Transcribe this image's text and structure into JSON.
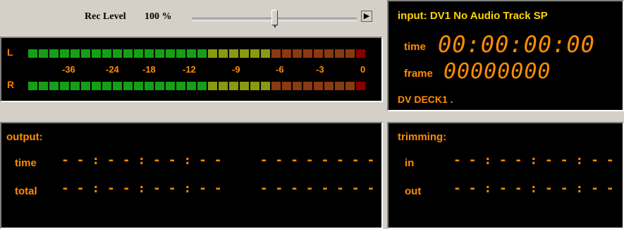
{
  "rec_level": {
    "label": "Rec Level",
    "value": "100 %",
    "slider_fraction": 0.5,
    "mute_icon": "speaker-icon"
  },
  "meter": {
    "left_label": "L",
    "right_label": "R",
    "scale": [
      "-36",
      "-24",
      "-18",
      "-12",
      "-9",
      "-6",
      "-3",
      "0"
    ],
    "colors": {
      "green": "#14a014",
      "yellow": "#8a9a10",
      "orange": "#8a3a10",
      "red": "#8a0000"
    }
  },
  "input": {
    "header": "input:  DV1  No Audio Track  SP",
    "time_label": "time",
    "time_value": "00:00:00:00",
    "frame_label": "frame",
    "frame_value": "00000000",
    "deck": "DV DECK1 ."
  },
  "output": {
    "title": "output:",
    "time_label": "time",
    "time_value": "- - : - - : - - : - -     - - - - - - - -",
    "total_label": "total",
    "total_value": "- - : - - : - - : - -     - - - - - - - -"
  },
  "trimming": {
    "title": "trimming:",
    "in_label": "in",
    "in_value": "- - : - - : - - : - -",
    "out_label": "out",
    "out_value": "- - : - - : - - : - -"
  }
}
